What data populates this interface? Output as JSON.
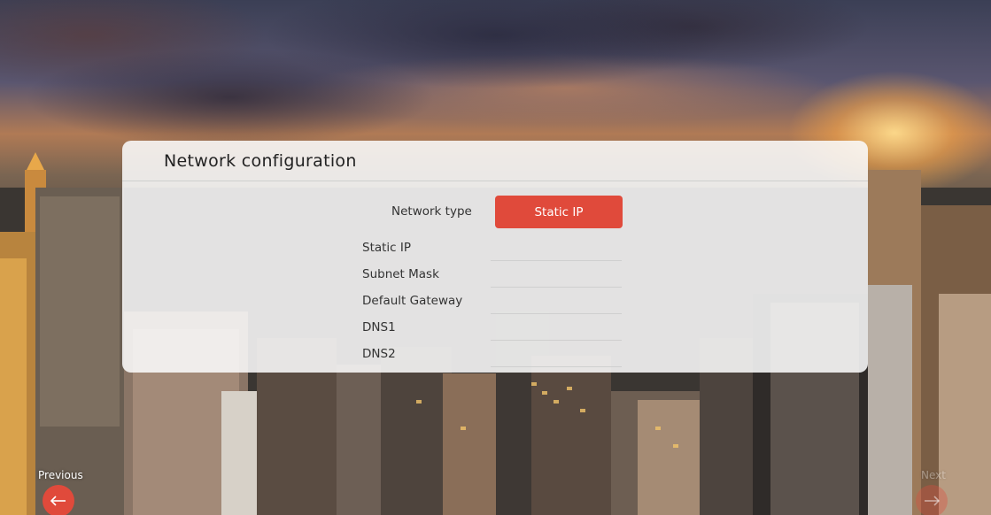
{
  "panel": {
    "title": "Network configuration"
  },
  "network_type": {
    "label": "Network type",
    "value": "Static IP"
  },
  "fields": [
    {
      "label": "Static IP",
      "value": ""
    },
    {
      "label": "Subnet Mask",
      "value": ""
    },
    {
      "label": "Default Gateway",
      "value": ""
    },
    {
      "label": "DNS1",
      "value": ""
    },
    {
      "label": "DNS2",
      "value": ""
    }
  ],
  "nav": {
    "previous_label": "Previous",
    "next_label": "Next"
  },
  "colors": {
    "accent": "#e04a3b",
    "panel_bg": "#fafafa"
  },
  "icons": {
    "previous": "arrow-left-icon",
    "next": "arrow-right-icon"
  }
}
